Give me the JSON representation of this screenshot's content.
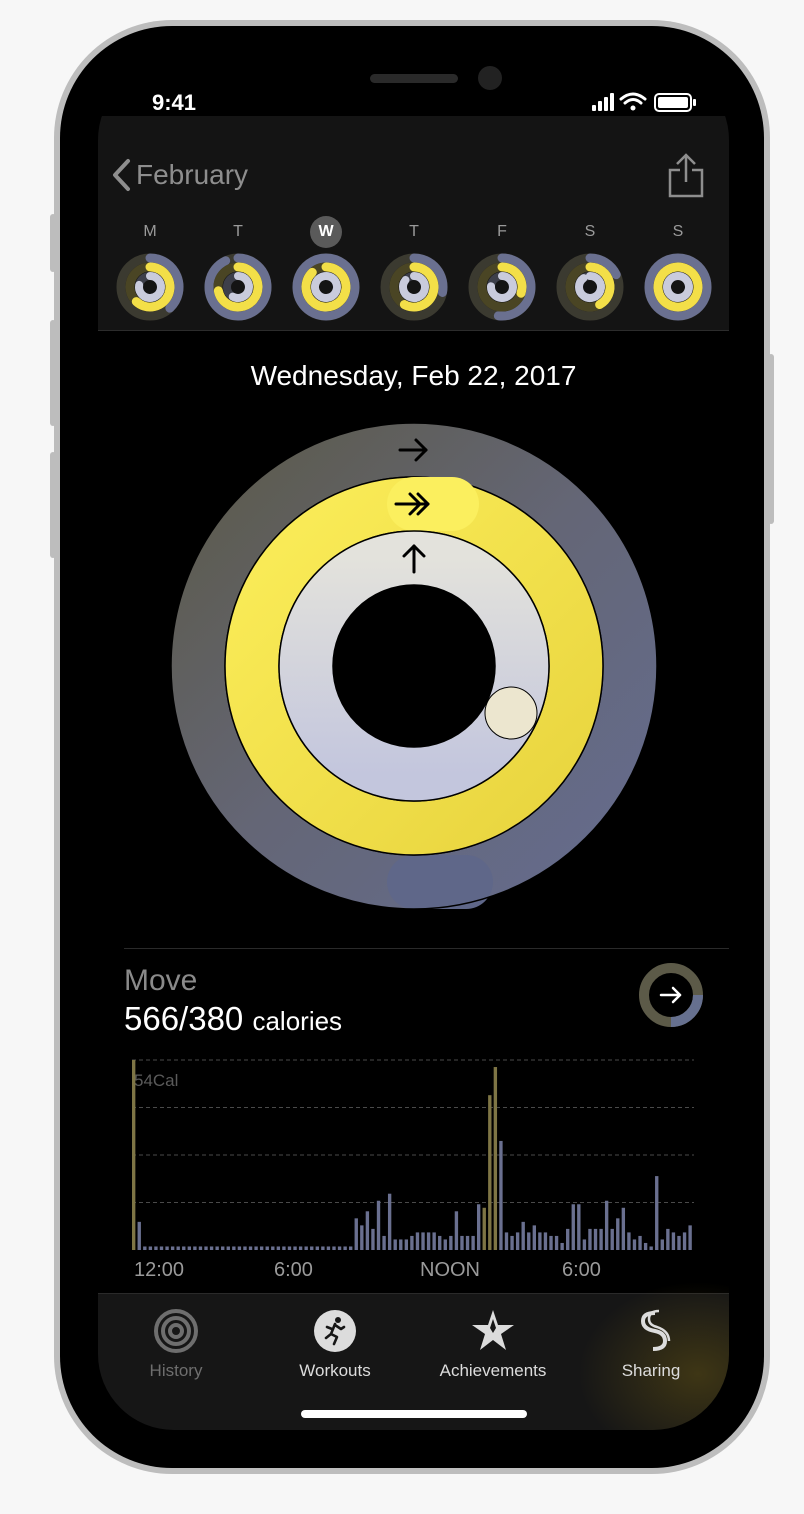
{
  "status": {
    "time": "9:41"
  },
  "header": {
    "back_label": "February",
    "days": [
      {
        "letter": "M",
        "move": 0.38,
        "exercise": 0.62,
        "stand": 0.78
      },
      {
        "letter": "T",
        "move": 0.93,
        "exercise": 0.72,
        "stand": 0.58
      },
      {
        "letter": "W",
        "move": 1.0,
        "exercise": 0.88,
        "stand": 0.98,
        "selected": true
      },
      {
        "letter": "T",
        "move": 0.28,
        "exercise": 0.58,
        "stand": 0.86
      },
      {
        "letter": "F",
        "move": 0.52,
        "exercise": 0.3,
        "stand": 0.76
      },
      {
        "letter": "S",
        "move": 0.18,
        "exercise": 0.42,
        "stand": 0.9
      },
      {
        "letter": "S",
        "move": 1.0,
        "exercise": 1.0,
        "stand": 1.0
      }
    ]
  },
  "summary": {
    "date": "Wednesday, Feb 22, 2017",
    "move_fraction": 1.49,
    "exercise_fraction": 1.04,
    "stand_fraction": 0.85
  },
  "move": {
    "label": "Move",
    "value": "566/380",
    "unit": "calories"
  },
  "chart_data": {
    "type": "bar",
    "title": "",
    "ylabel": "54Cal",
    "x_ticks": [
      "12:00",
      "6:00",
      "NOON",
      "6:00"
    ],
    "values": [
      54,
      8,
      1,
      1,
      1,
      1,
      1,
      1,
      1,
      1,
      1,
      1,
      1,
      1,
      1,
      1,
      1,
      1,
      1,
      1,
      1,
      1,
      1,
      1,
      1,
      1,
      1,
      1,
      1,
      1,
      1,
      1,
      1,
      1,
      1,
      1,
      1,
      1,
      1,
      1,
      9,
      7,
      11,
      6,
      14,
      4,
      16,
      3,
      3,
      3,
      4,
      5,
      5,
      5,
      5,
      4,
      3,
      4,
      11,
      4,
      4,
      4,
      13,
      12,
      44,
      52,
      31,
      5,
      4,
      5,
      8,
      5,
      7,
      5,
      5,
      4,
      4,
      2,
      6,
      13,
      13,
      3,
      6,
      6,
      6,
      14,
      6,
      9,
      12,
      5,
      3,
      4,
      2,
      1,
      21,
      3,
      6,
      5,
      4,
      5,
      7
    ],
    "highlight": {
      "0": 54,
      "63": 44,
      "64": 52,
      "65": 31
    }
  },
  "tabs": [
    {
      "label": "History",
      "icon": "history-rings-icon",
      "active": false
    },
    {
      "label": "Workouts",
      "icon": "runner-icon",
      "active": true
    },
    {
      "label": "Achievements",
      "icon": "star-award-icon",
      "active": true
    },
    {
      "label": "Sharing",
      "icon": "sharing-icon",
      "active": true
    }
  ],
  "colors": {
    "move_ring": "#5f5f49",
    "move_ring_end": "#65708f",
    "exercise_ring": "#f4e04b",
    "stand_ring": "#c8cbe0",
    "chart_bar": "#6a7090",
    "chart_bar_high": "#7e7545"
  }
}
